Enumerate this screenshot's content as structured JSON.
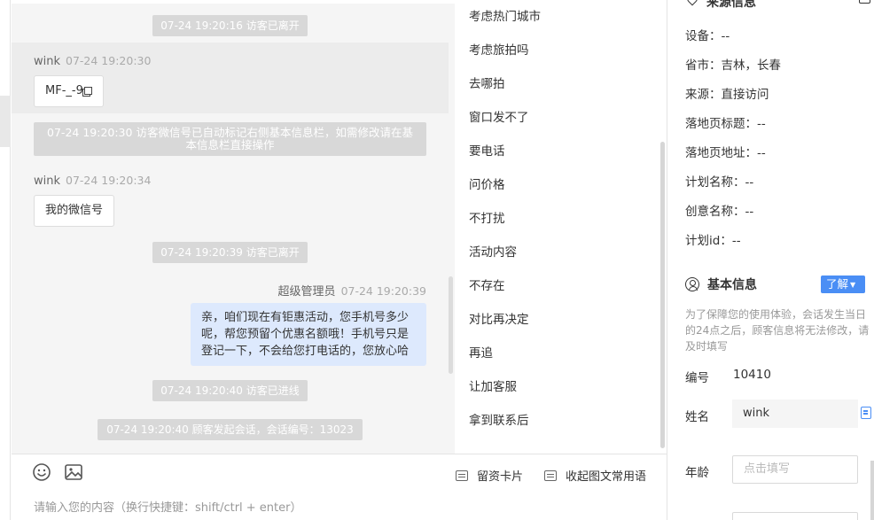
{
  "chat": {
    "messages": [
      {
        "type": "system",
        "text": "07-24 19:20:16 访客已离开"
      },
      {
        "type": "visitor",
        "sender": "wink",
        "time": "07-24 19:20:30",
        "text": "MF-_-9"
      },
      {
        "type": "system",
        "text": "07-24 19:20:30 访客微信号已自动标记右侧基本信息栏，如需修改请在基本信息栏直接操作"
      },
      {
        "type": "visitor",
        "sender": "wink",
        "time": "07-24 19:20:34",
        "text": "我的微信号"
      },
      {
        "type": "system",
        "text": "07-24 19:20:39 访客已离开"
      },
      {
        "type": "agent",
        "sender": "超级管理员",
        "time": "07-24 19:20:39",
        "text": "亲，咱们现在有钜惠活动，您手机号多少呢，帮您预留个优惠名额哦！手机号只是登记一下，不会给您打电话的，您放心哈"
      },
      {
        "type": "system",
        "text": "07-24 19:20:40 访客已进线"
      },
      {
        "type": "system",
        "text": "07-24 19:20:40 顾客发起会话，会话编号：13023"
      }
    ]
  },
  "quick_replies": [
    "考虑热门城市",
    "考虑旅拍吗",
    "去哪拍",
    "窗口发不了",
    "要电话",
    "问价格",
    "不打扰",
    "活动内容",
    "不存在",
    "对比再决定",
    "再追",
    "让加客服",
    "拿到联系后"
  ],
  "toolbar": {
    "emoji_icon": "emoji-icon",
    "image_icon": "image-icon",
    "card_label": "留资卡片",
    "collapse_label": "收起图文常用语",
    "input_placeholder": "请输入您的内容（换行快捷键：shift/ctrl + enter）"
  },
  "source_info": {
    "title": "来源信息",
    "rows": [
      "设备：--",
      "省市：吉林，长春",
      "来源：直接访问",
      "落地页标题：--",
      "落地页地址：--",
      "计划名称：--",
      "创意名称：--",
      "计划id：--"
    ]
  },
  "basic_info": {
    "title": "基本信息",
    "know_button": "了解",
    "notice": "为了保障您的使用体验，会话发生当日的24点之后，顾客信息将无法修改，请及时填写",
    "id_label": "编号",
    "id_value": "10410",
    "name_label": "姓名",
    "name_value": "wink",
    "age_label": "年龄",
    "age_placeholder": "点击填写"
  },
  "colors": {
    "accent": "#4a8ef5",
    "agent_bubble": "#dde9fd",
    "system_bg": "#d8d8d8"
  }
}
